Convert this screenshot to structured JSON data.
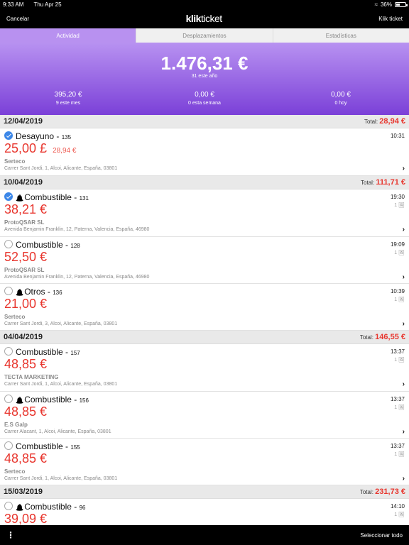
{
  "status": {
    "time": "9:33 AM",
    "date": "Thu Apr 25",
    "battery": "36%"
  },
  "nav": {
    "cancel": "Cancelar",
    "logo_bold": "klik",
    "logo_thin": "ticket",
    "right": "Klik ticket"
  },
  "tabs": [
    "Actividad",
    "Desplazamientos",
    "Estadísticas"
  ],
  "summary": {
    "total": "1.476,31 €",
    "total_sub": "31 este año",
    "stats": [
      {
        "value": "395,20 €",
        "label": "9 este mes"
      },
      {
        "value": "0,00 €",
        "label": "0 esta semana"
      },
      {
        "value": "0,00 €",
        "label": "0 hoy"
      }
    ]
  },
  "total_prefix": "Total:",
  "days": [
    {
      "date": "12/04/2019",
      "total": "28,94 €",
      "items": [
        {
          "checked": true,
          "bell": false,
          "title": "Desayuno",
          "id": "135",
          "time": "10:31",
          "count": "",
          "amount": "25,00 £",
          "orig": "28,94 €",
          "merchant": "Serteco",
          "address": "Carrer Sant Jordi, 1, Alcoi, Alicante, España, 03801"
        }
      ]
    },
    {
      "date": "10/04/2019",
      "total": "111,71 €",
      "items": [
        {
          "checked": true,
          "bell": true,
          "title": "Combustible",
          "id": "131",
          "time": "19:30",
          "count": "1",
          "amount": "38,21 €",
          "orig": "",
          "merchant": "ProtoQSAR SL",
          "address": "Avenida Benjamin Franklin, 12, Paterna, Valencia, España, 46980"
        },
        {
          "checked": false,
          "bell": false,
          "title": "Combustible",
          "id": "128",
          "time": "19:09",
          "count": "1",
          "amount": "52,50 €",
          "orig": "",
          "merchant": "ProtoQSAR SL",
          "address": "Avenida Benjamin Franklin, 12, Paterna, Valencia, España, 46980"
        },
        {
          "checked": false,
          "bell": true,
          "title": "Otros",
          "id": "136",
          "time": "10:39",
          "count": "1",
          "amount": "21,00 €",
          "orig": "",
          "merchant": "Serteco",
          "address": "Carrer Sant Jordi, 3, Alcoi, Alicante, España, 03801"
        }
      ]
    },
    {
      "date": "04/04/2019",
      "total": "146,55 €",
      "items": [
        {
          "checked": false,
          "bell": false,
          "title": "Combustible",
          "id": "157",
          "time": "13:37",
          "count": "1",
          "amount": "48,85 €",
          "orig": "",
          "merchant": "TECTA MARKETING",
          "address": "Carrer Sant Jordi, 1, Alcoi, Alicante, España, 03801"
        },
        {
          "checked": false,
          "bell": true,
          "title": "Combustible",
          "id": "156",
          "time": "13:37",
          "count": "1",
          "amount": "48,85 €",
          "orig": "",
          "merchant": "E.S Galp",
          "address": "Carrer Alacant, 1, Alcoi, Alicante, España, 03801"
        },
        {
          "checked": false,
          "bell": false,
          "title": "Combustible",
          "id": "155",
          "time": "13:37",
          "count": "1",
          "amount": "48,85 €",
          "orig": "",
          "merchant": "Serteco",
          "address": "Carrer Sant Jordi, 1, Alcoi, Alicante, España, 03801"
        }
      ]
    },
    {
      "date": "15/03/2019",
      "total": "231,73 €",
      "items": [
        {
          "checked": false,
          "bell": true,
          "title": "Combustible",
          "id": "96",
          "time": "14:10",
          "count": "1",
          "amount": "39,09 €",
          "orig": "",
          "merchant": "",
          "address": ""
        }
      ]
    }
  ],
  "bottom": {
    "more_icon": "more-vertical-icon",
    "select_all": "Seleccionar todo"
  }
}
